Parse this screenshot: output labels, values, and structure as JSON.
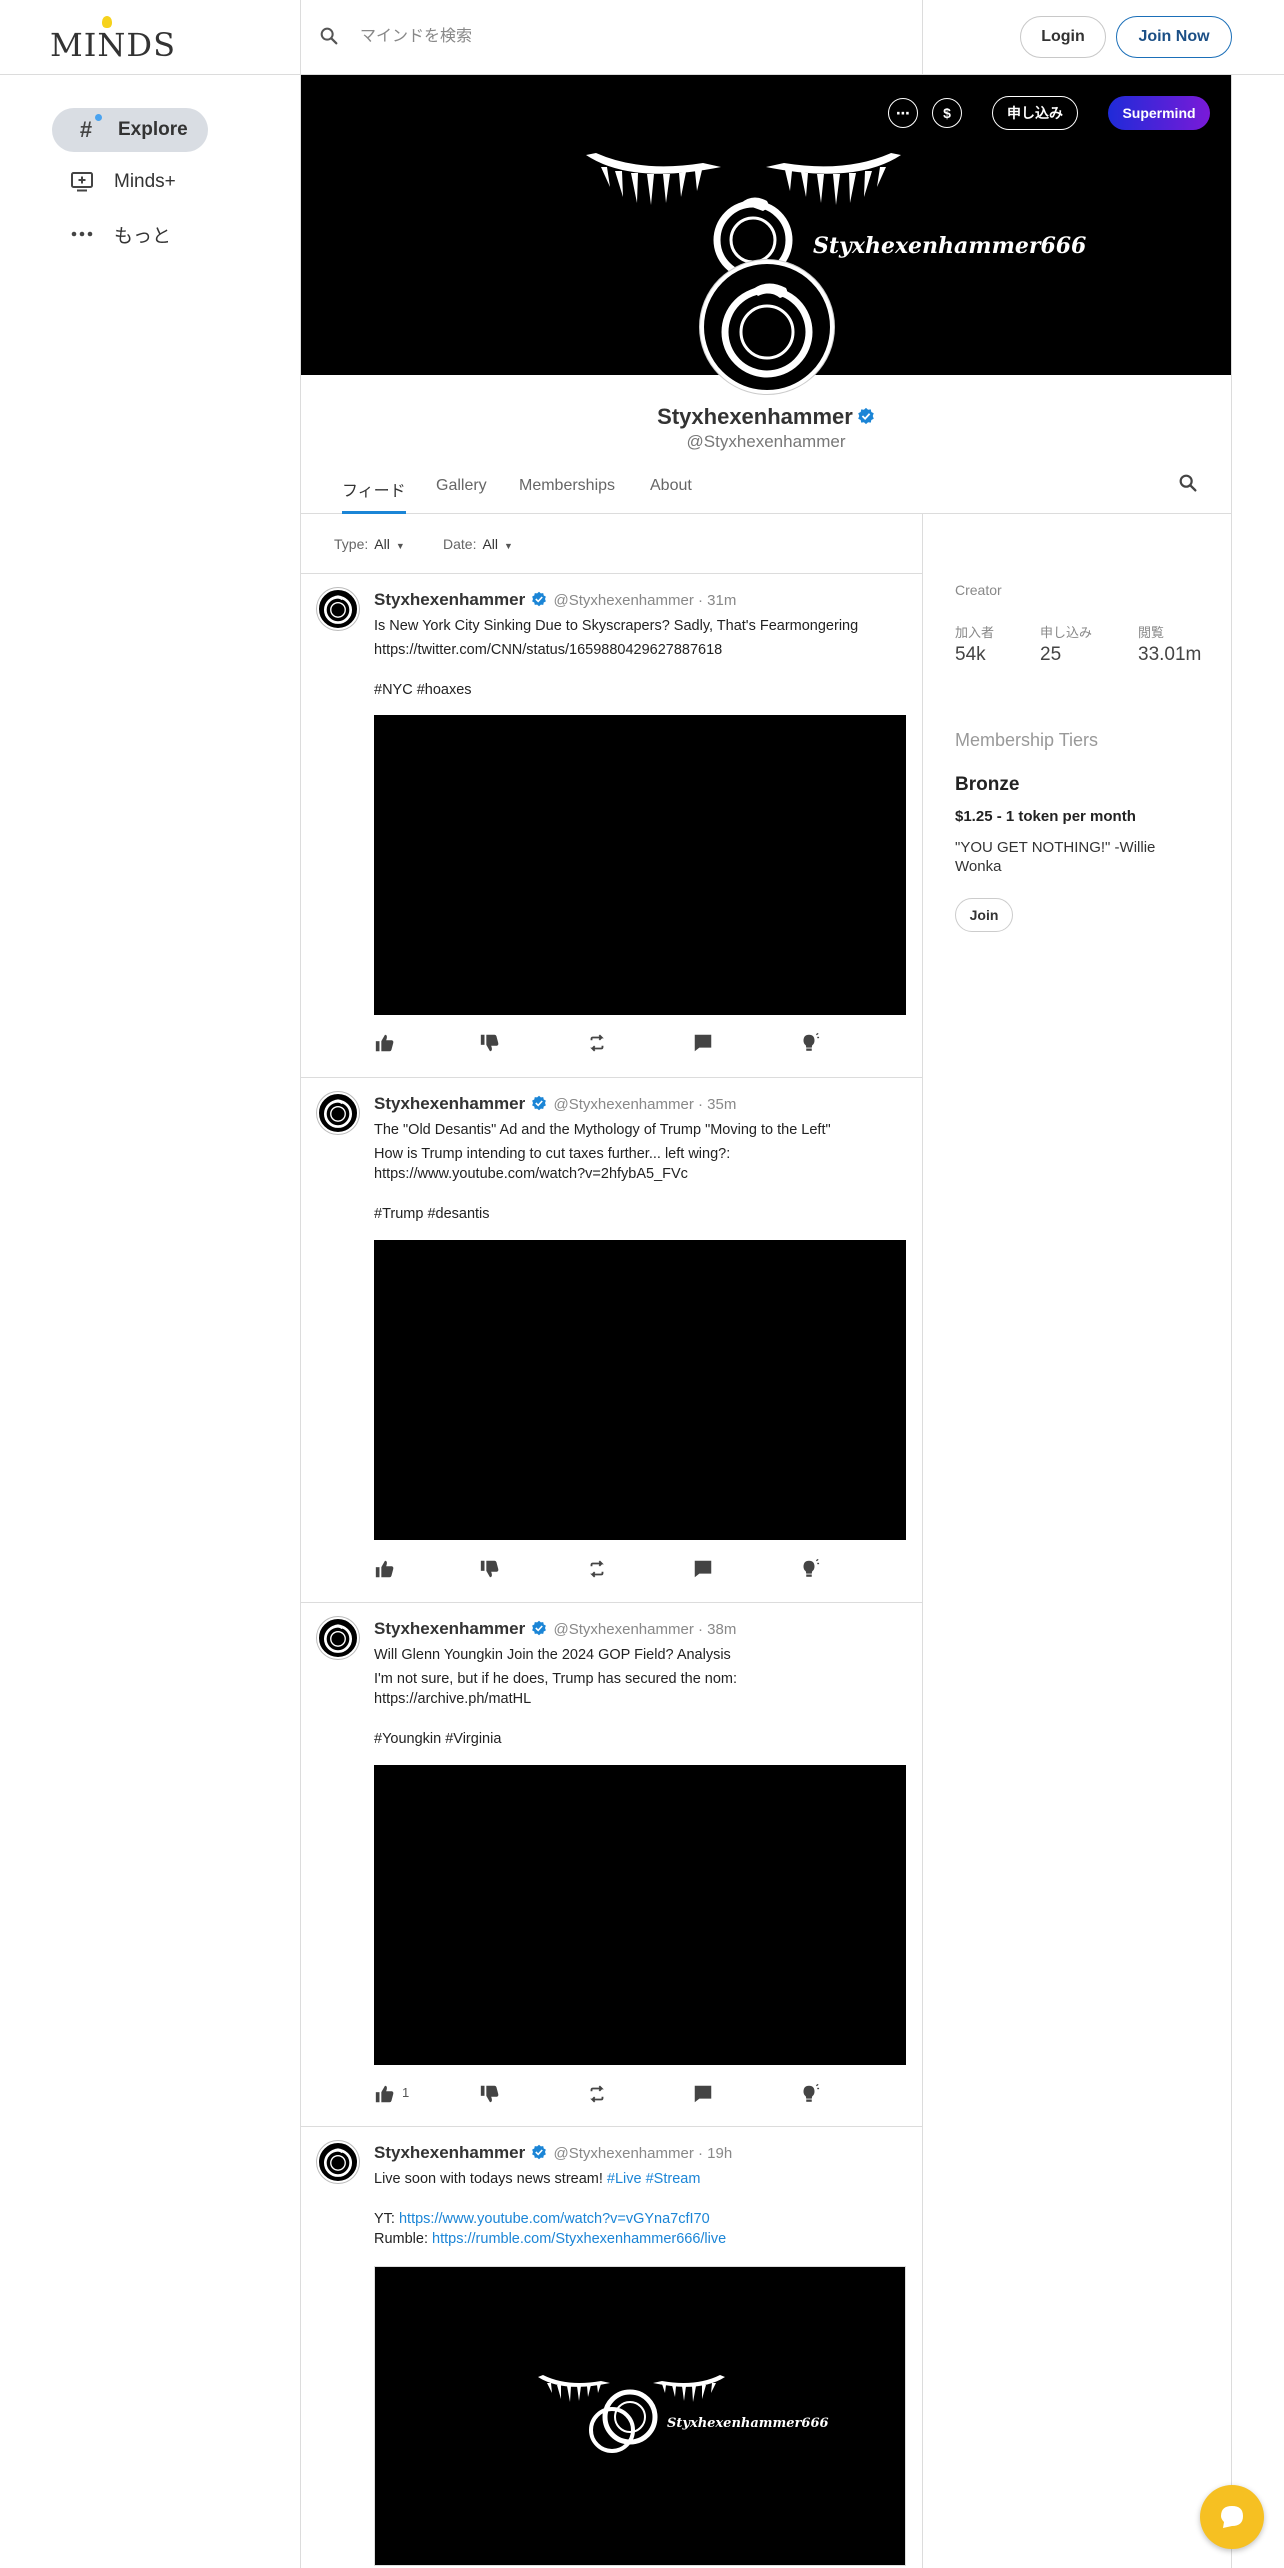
{
  "header": {
    "logo_text": "MINDS",
    "search_placeholder": "マインドを検索",
    "login_label": "Login",
    "join_label": "Join Now"
  },
  "sidebar": {
    "items": [
      {
        "label": "Explore",
        "icon": "hashtag-icon"
      },
      {
        "label": "Minds+",
        "icon": "minds-plus-icon"
      },
      {
        "label": "もっと",
        "icon": "more-icon"
      }
    ]
  },
  "banner": {
    "more_label": "⋯",
    "tip_label": "$",
    "subscribe_label": "申し込み",
    "supermind_label": "Supermind",
    "banner_text": "Styxhexenhammer666"
  },
  "profile": {
    "name": "Styxhexenhammer",
    "handle": "@Styxhexenhammer"
  },
  "tabs": [
    "フィード",
    "Gallery",
    "Memberships",
    "About"
  ],
  "filters": {
    "type_label": "Type:",
    "type_value": "All",
    "date_label": "Date:",
    "date_value": "All"
  },
  "sidebar_right": {
    "creator_label": "Creator",
    "stats": [
      {
        "label": "加入者",
        "value": "54k"
      },
      {
        "label": "申し込み",
        "value": "25"
      },
      {
        "label": "閲覧",
        "value": "33.01m"
      }
    ],
    "tiers_title": "Membership Tiers",
    "tier": {
      "name": "Bronze",
      "price": "$1.25 - 1 token per month",
      "description": "\"YOU GET NOTHING!\" -Willie Wonka",
      "join_label": "Join"
    }
  },
  "posts": [
    {
      "author": "Styxhexenhammer",
      "meta": "@Styxhexenhammer · 31m",
      "title": "Is New York City Sinking Due to Skyscrapers? Sadly, That's Fearmongering",
      "body": "",
      "link": "https://twitter.com/CNN/status/1659880429627887618",
      "tags": "#NYC #hoaxes",
      "up_count": ""
    },
    {
      "author": "Styxhexenhammer",
      "meta": "@Styxhexenhammer · 35m",
      "title": "The \"Old Desantis\" Ad and the Mythology of Trump \"Moving to the Left\"",
      "body": "How is Trump intending to cut taxes further... left wing?:",
      "link": "https://www.youtube.com/watch?v=2hfybA5_FVc",
      "tags": "#Trump #desantis",
      "up_count": ""
    },
    {
      "author": "Styxhexenhammer",
      "meta": "@Styxhexenhammer · 38m",
      "title": "Will Glenn Youngkin Join the 2024 GOP Field? Analysis",
      "body": "I'm not sure, but if he does, Trump has secured the nom:",
      "link": "https://archive.ph/matHL",
      "tags": "#Youngkin #Virginia",
      "up_count": "1"
    },
    {
      "author": "Styxhexenhammer",
      "meta": "@Styxhexenhammer · 19h",
      "title": "Live soon with todays news stream!",
      "title_tags": "#Live #Stream",
      "yt_label": "YT:",
      "yt_link": "https://www.youtube.com/watch?v=vGYna7cfI70",
      "rumble_label": "Rumble:",
      "rumble_link": "https://rumble.com/Styxhexenhammer666/live",
      "thumb_text": "Styxhexenhammer666"
    }
  ],
  "colors": {
    "accent": "#1b85d6",
    "supermind_start": "#1f2bd8",
    "supermind_end": "#7a1ad8",
    "chat_bubble": "#f6c022"
  }
}
